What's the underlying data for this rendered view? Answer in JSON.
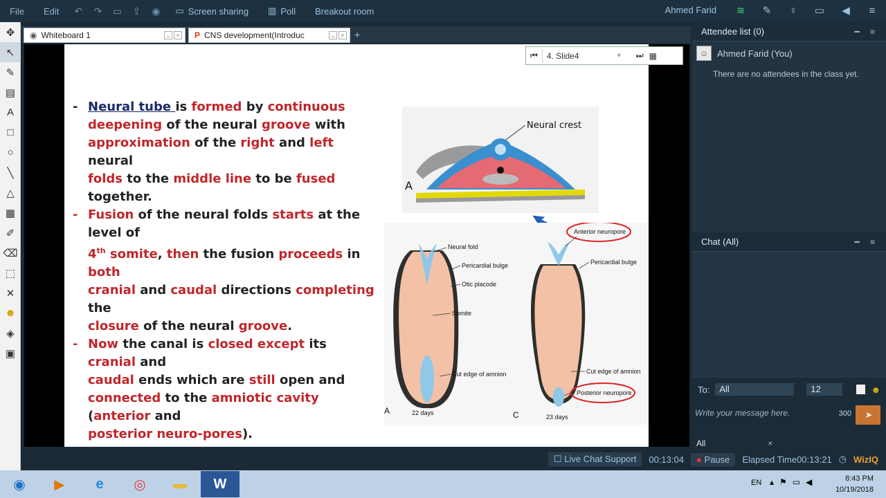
{
  "menu": {
    "file": "File",
    "edit": "Edit",
    "screen_sharing": "Screen sharing",
    "poll": "Poll",
    "breakout_room": "Breakout room",
    "user_name": "Ahmed Farid"
  },
  "tabs": [
    {
      "label": "Whiteboard 1"
    },
    {
      "label": "CNS development(Introduc"
    }
  ],
  "slide_nav": {
    "current": "4. Slide4"
  },
  "slide": {
    "b1": {
      "p1": "Neural tube ",
      "p2": "is ",
      "p3": "formed",
      "p4": " by ",
      "p5": "continuous",
      "p6": "deepening",
      "p7": " of the neural ",
      "p8": "groove",
      "p9": " with",
      "p10": "approximation",
      "p11": " of the ",
      "p12": "right",
      "p13": " and ",
      "p14": "left",
      "p15": " neural",
      "p16": "folds",
      "p17": " to the ",
      "p18": "middle line",
      "p19": " to be ",
      "p20": "fused",
      "p21": " together."
    },
    "b2": {
      "p1": "Fusion",
      "p2": " of the neural folds ",
      "p3": "starts",
      "p4": " at the level of",
      "p5": "4",
      "p6": "th",
      "p7": " somite",
      "p8": ", ",
      "p9": "then",
      "p10": " the fusion ",
      "p11": "proceeds",
      "p12": " in ",
      "p13": "both",
      "p14": "cranial",
      "p15": " and ",
      "p16": "caudal",
      "p17": " directions ",
      "p18": "completing",
      "p19": " the",
      "p20": "closure",
      "p21": " of the neural ",
      "p22": "groove",
      "p23": "."
    },
    "b3": {
      "p1": "Now",
      "p2": " the canal is ",
      "p3": "closed except",
      "p4": " its ",
      "p5": "cranial",
      "p6": " and",
      "p7": "caudal",
      "p8": " ends which are ",
      "p9": "still",
      "p10": " open and",
      "p11": "connected",
      "p12": " to the ",
      "p13": "amniotic cavity",
      "p14": " (",
      "p15": "anterior",
      "p16": " and",
      "p17": "posterior neuro-pores",
      "p18": ")."
    },
    "figure_top": {
      "label_neural_crest": "Neural crest",
      "letter": "A"
    },
    "figure_bottom": {
      "neural_fold": "Neural fold",
      "pericardial_bulge_left": "Pericardial bulge",
      "otic_placode": "Otic placode",
      "somite": "Somite",
      "cut_edge_left": "Cut edge of amnion",
      "letter_a": "A",
      "days_a": "22 days",
      "anterior_neuropore": "Anterior neuropore",
      "pericardial_bulge_right": "Pericardial bulge",
      "cut_edge_right": "Cut edge of amnion",
      "posterior_neuropore": "Posterior neuropore",
      "letter_c": "C",
      "days_c": "23 days"
    }
  },
  "attendee_panel": {
    "title": "Attendee list (0)",
    "me": "Ahmed Farid (You)",
    "empty_msg": "There are no attendees in the class yet."
  },
  "chat_panel": {
    "title": "Chat (All)",
    "to_label": "To:",
    "to_value": "All",
    "font_size": "12",
    "placeholder": "Write your message here.",
    "char_count": "300",
    "filter_tab": "All"
  },
  "status": {
    "live_chat": "Live Chat Support",
    "session_time": "00:13:04",
    "pause": "Pause",
    "elapsed_label": "Elapsed Time",
    "elapsed_value": "00:13:21",
    "brand": "WizIQ"
  },
  "taskbar": {
    "lang": "EN",
    "time": "8:43 PM",
    "date": "10/19/2018"
  },
  "colors": {
    "accent_red": "#c0262a",
    "navy": "#1a2a6b",
    "dark_panel": "#223342"
  }
}
